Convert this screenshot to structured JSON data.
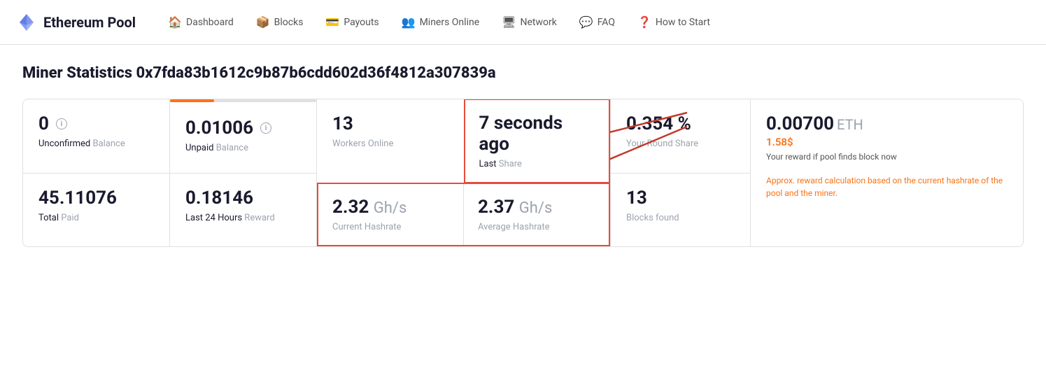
{
  "header": {
    "logo_text": "Ethereum Pool",
    "nav": [
      {
        "label": "Dashboard",
        "icon": "🏠"
      },
      {
        "label": "Blocks",
        "icon": "📦"
      },
      {
        "label": "Payouts",
        "icon": "💳"
      },
      {
        "label": "Miners Online",
        "icon": "👥"
      },
      {
        "label": "Network",
        "icon": "🖥"
      },
      {
        "label": "FAQ",
        "icon": "💬"
      },
      {
        "label": "How to Start",
        "icon": "❓"
      }
    ]
  },
  "page": {
    "title": "Miner Statistics 0x7fda83b1612c9b87b6cdd602d36f4812a307839a"
  },
  "stats": {
    "unconfirmed_balance": "0",
    "unconfirmed_label_highlight": "Unconfirmed",
    "unconfirmed_label_rest": " Balance",
    "unpaid_balance": "0.01006",
    "unpaid_label_highlight": "Unpaid",
    "unpaid_label_rest": " Balance",
    "total_paid": "45.11076",
    "total_paid_label_highlight": "Total",
    "total_paid_label_rest": " Paid",
    "last24_reward": "0.18146",
    "last24_label": "Last 24 Hours",
    "last24_label_rest": " Reward",
    "workers_online": "13",
    "workers_label": "Workers Online",
    "last_share": "7 seconds ago",
    "last_share_label_highlight": "Last",
    "last_share_label_rest": " Share",
    "current_hashrate_value": "2.32",
    "current_hashrate_unit": "Gh/s",
    "current_hashrate_label": "Current Hashrate",
    "average_hashrate_value": "2.37",
    "average_hashrate_unit": "Gh/s",
    "average_hashrate_label": "Average Hashrate",
    "round_share": "0.354 %",
    "round_share_label": "Your Round Share",
    "blocks_found": "13",
    "blocks_found_label": "Blocks found",
    "reward_eth": "0.00700",
    "reward_eth_unit": "ETH",
    "reward_usd": "1.58$",
    "reward_desc": "Your reward if pool finds block now",
    "reward_approx": "Approx. reward calculation based on the current hashrate of the pool and the miner."
  }
}
